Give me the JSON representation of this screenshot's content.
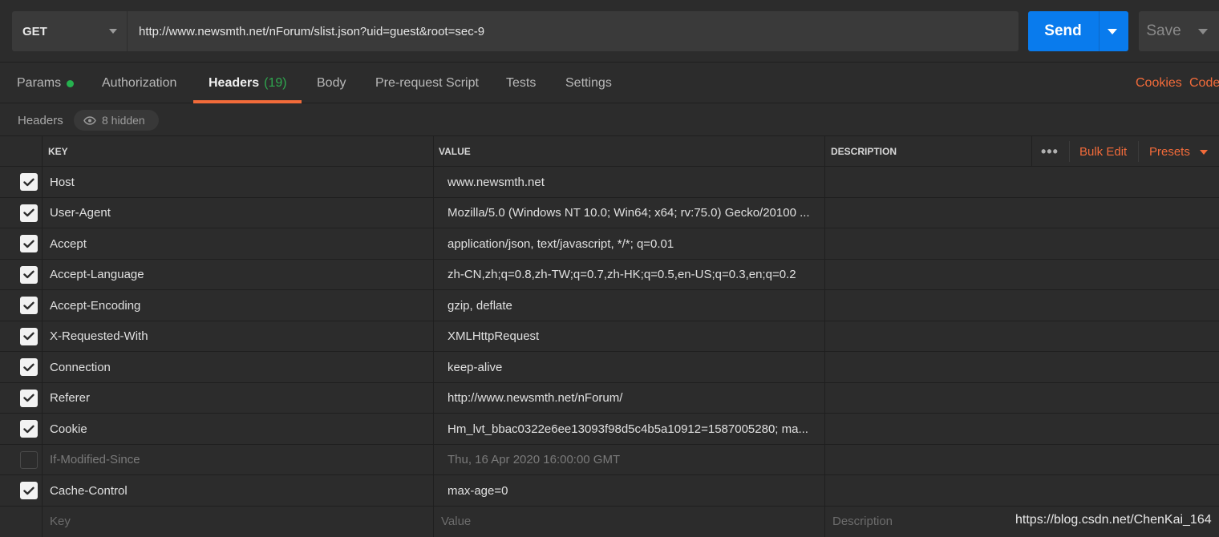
{
  "request": {
    "method": "GET",
    "url": "http://www.newsmth.net/nForum/slist.json?uid=guest&root=sec-9",
    "send_label": "Send",
    "save_label": "Save"
  },
  "tabs": [
    {
      "label": "Params",
      "dot": true
    },
    {
      "label": "Authorization"
    },
    {
      "label": "Headers",
      "count": "(19)",
      "active": true
    },
    {
      "label": "Body"
    },
    {
      "label": "Pre-request Script"
    },
    {
      "label": "Tests"
    },
    {
      "label": "Settings"
    }
  ],
  "tab_links": {
    "cookies": "Cookies",
    "code": "Code"
  },
  "headers_bar": {
    "title": "Headers",
    "hidden": "8 hidden"
  },
  "table": {
    "columns": {
      "key": "KEY",
      "value": "VALUE",
      "description": "DESCRIPTION"
    },
    "toolbar": {
      "more": "•••",
      "bulk_edit": "Bulk Edit",
      "presets": "Presets"
    },
    "rows": [
      {
        "checked": true,
        "key": "Host",
        "value": "www.newsmth.net"
      },
      {
        "checked": true,
        "key": "User-Agent",
        "value": "Mozilla/5.0 (Windows NT 10.0; Win64; x64; rv:75.0) Gecko/20100 ..."
      },
      {
        "checked": true,
        "key": "Accept",
        "value": "application/json, text/javascript, */*; q=0.01"
      },
      {
        "checked": true,
        "key": "Accept-Language",
        "value": "zh-CN,zh;q=0.8,zh-TW;q=0.7,zh-HK;q=0.5,en-US;q=0.3,en;q=0.2"
      },
      {
        "checked": true,
        "key": "Accept-Encoding",
        "value": "gzip, deflate"
      },
      {
        "checked": true,
        "key": "X-Requested-With",
        "value": "XMLHttpRequest"
      },
      {
        "checked": true,
        "key": "Connection",
        "value": "keep-alive"
      },
      {
        "checked": true,
        "key": "Referer",
        "value": "http://www.newsmth.net/nForum/"
      },
      {
        "checked": true,
        "key": "Cookie",
        "value": "Hm_lvt_bbac0322e6ee13093f98d5c4b5a10912=1587005280; ma..."
      },
      {
        "checked": false,
        "key": "If-Modified-Since",
        "value": "Thu, 16 Apr 2020 16:00:00 GMT"
      },
      {
        "checked": true,
        "key": "Cache-Control",
        "value": "max-age=0"
      }
    ],
    "placeholder": {
      "key": "Key",
      "value": "Value",
      "description": "Description"
    }
  },
  "watermark": "https://blog.csdn.net/ChenKai_164",
  "colors": {
    "accent": "#f26b3a",
    "send": "#097bed",
    "dot": "#26b14f"
  }
}
